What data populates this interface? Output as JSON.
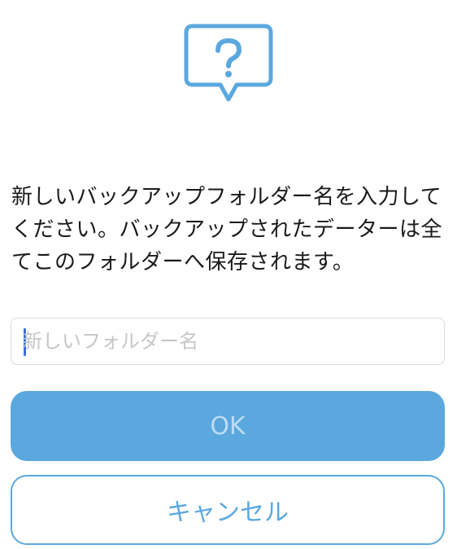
{
  "dialog": {
    "icon": "question-speech-bubble-icon",
    "message": "新しいバックアップフォルダー名を入力してください。バックアップされたデーターは全てこのフォルダーへ保存されます。"
  },
  "folder_input": {
    "value": "",
    "placeholder": "新しいフォルダー名"
  },
  "buttons": {
    "ok_label": "OK",
    "cancel_label": "キャンセル"
  },
  "colors": {
    "accent": "#5ba8df",
    "ok_text_disabled": "#bcdcf3",
    "caret": "#3a6fd8"
  }
}
